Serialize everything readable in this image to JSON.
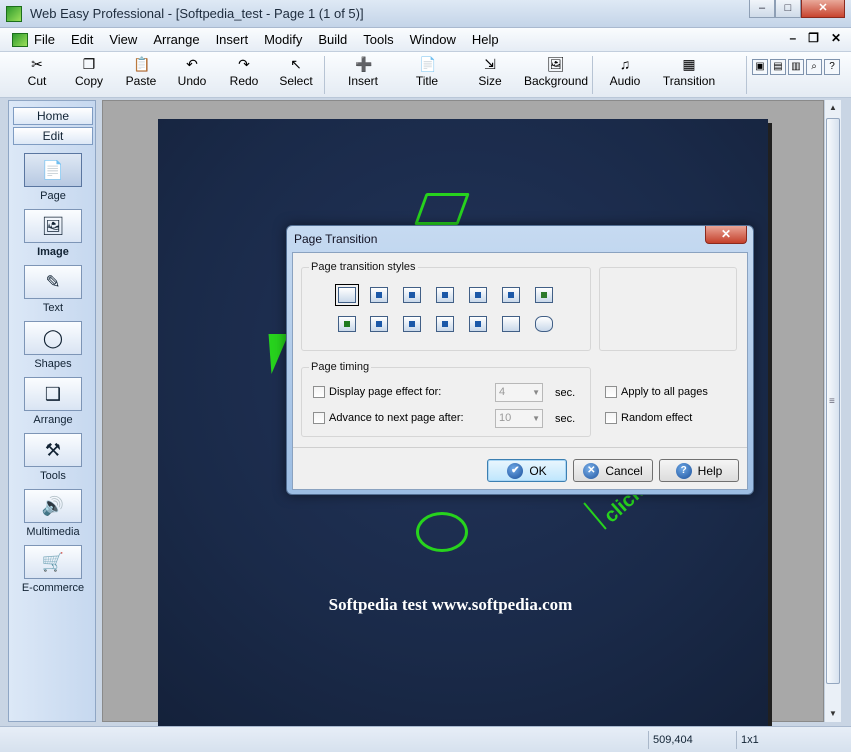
{
  "window": {
    "title": "Web Easy Professional - [Softpedia_test - Page 1 (1 of 5)]",
    "buttons": [
      "–",
      "□",
      "✕"
    ]
  },
  "menu": {
    "items": [
      "File",
      "Edit",
      "View",
      "Arrange",
      "Insert",
      "Modify",
      "Build",
      "Tools",
      "Window",
      "Help"
    ],
    "mdi": [
      "–",
      "❐",
      "✕"
    ]
  },
  "toolbar": {
    "buttons": [
      {
        "label": "Cut",
        "icon": "✂"
      },
      {
        "label": "Copy",
        "icon": "❐"
      },
      {
        "label": "Paste",
        "icon": "📋"
      },
      {
        "label": "Undo",
        "icon": "↶"
      },
      {
        "label": "Redo",
        "icon": "↷"
      },
      {
        "label": "Select",
        "icon": "↖"
      },
      {
        "label": "Insert",
        "icon": "➕"
      },
      {
        "label": "Title",
        "icon": "📄"
      },
      {
        "label": "Size",
        "icon": "⇲"
      },
      {
        "label": "Background",
        "icon": "🖼"
      },
      {
        "label": "Audio",
        "icon": "♫"
      },
      {
        "label": "Transition",
        "icon": "▦"
      }
    ],
    "mini_icons": [
      "▣",
      "▤",
      "▥",
      "⌕",
      "?"
    ]
  },
  "sidebar": {
    "nav": [
      "Home",
      "Edit"
    ],
    "tools": [
      {
        "label": "Page",
        "icon": "📄"
      },
      {
        "label": "Image",
        "icon": "🖼"
      },
      {
        "label": "Text",
        "icon": "✎"
      },
      {
        "label": "Shapes",
        "icon": "◯"
      },
      {
        "label": "Arrange",
        "icon": "❑"
      },
      {
        "label": "Tools",
        "icon": "⚒"
      },
      {
        "label": "Multimedia",
        "icon": "🔊"
      },
      {
        "label": "E-commerce",
        "icon": "🛒"
      }
    ]
  },
  "page": {
    "footer_text": "Softpedia test www.softpedia.com",
    "decor_text": "click"
  },
  "colors": {
    "accent_green": "#27d31d",
    "page_bg": "#1a2a49"
  },
  "status": {
    "coords": "509,404",
    "zoom": "1x1"
  },
  "dialog": {
    "title": "Page Transition",
    "styles_group": "Page transition styles",
    "timing_group": "Page timing",
    "display_effect_label": "Display page effect for:",
    "display_effect_value": "4",
    "advance_label": "Advance to next page after:",
    "advance_value": "10",
    "unit": "sec.",
    "apply_all_label": "Apply to all pages",
    "random_label": "Random effect",
    "ok": "OK",
    "cancel": "Cancel",
    "help": "Help",
    "ok_icon": "✔",
    "cancel_icon": "✕",
    "help_icon": "?"
  }
}
